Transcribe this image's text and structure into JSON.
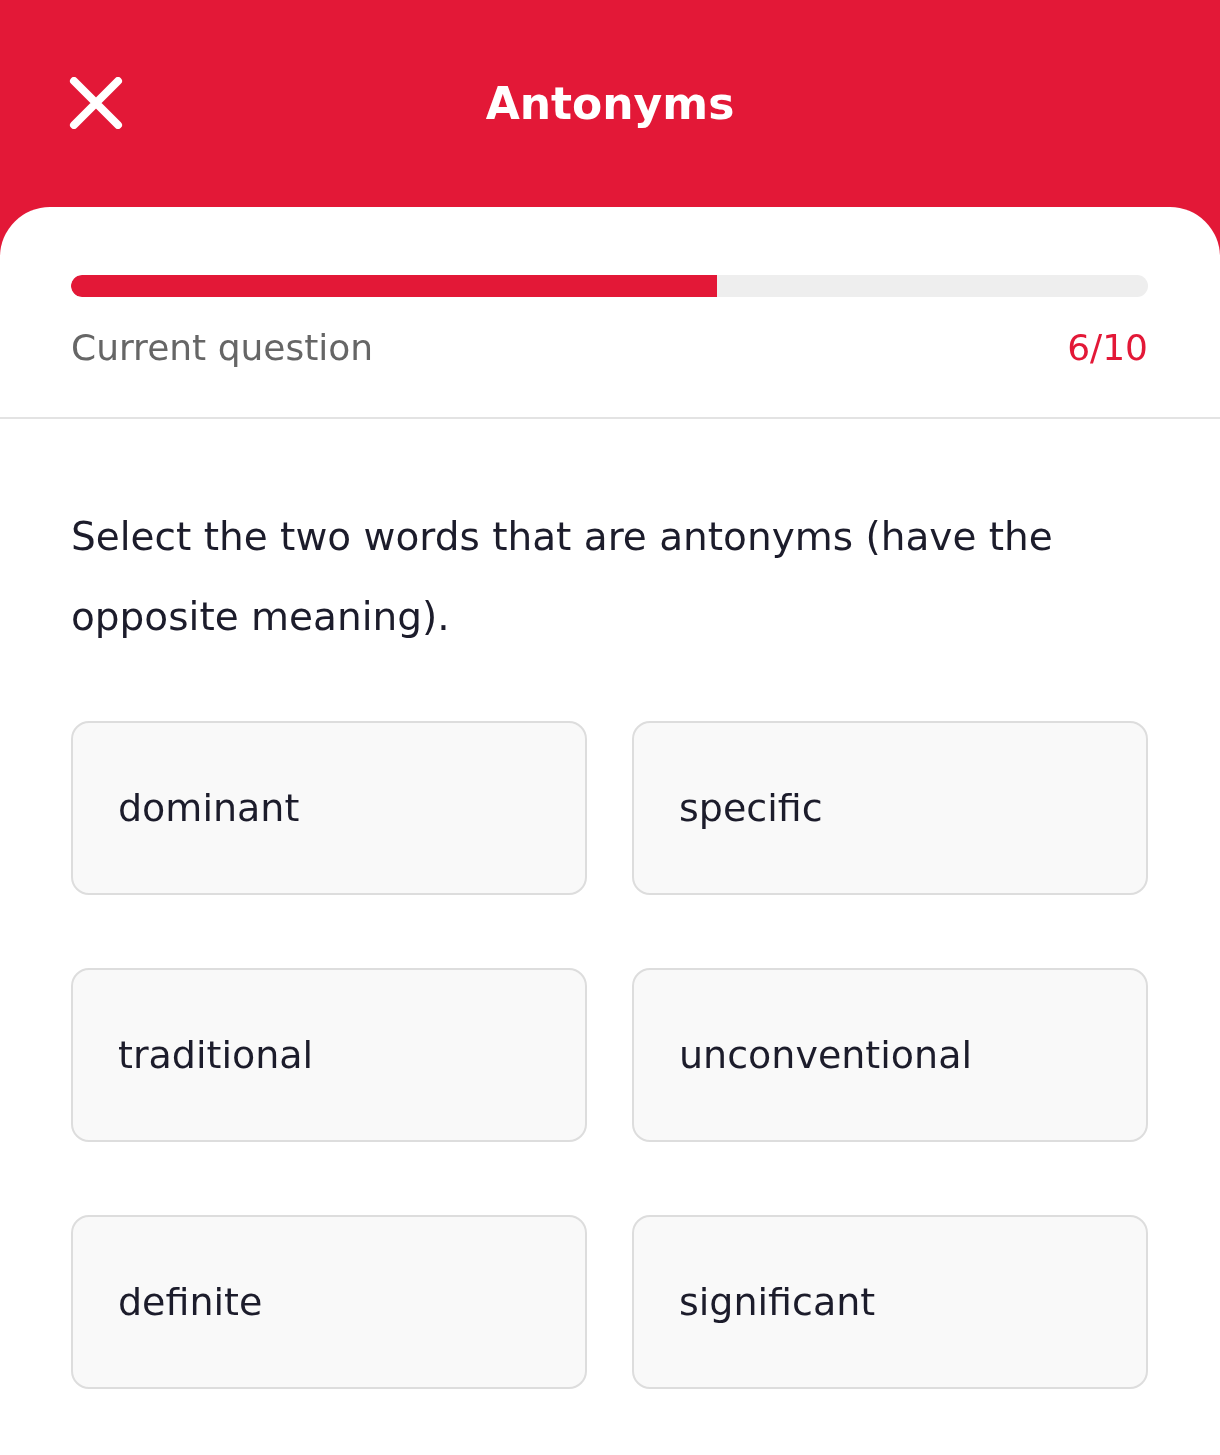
{
  "header": {
    "title": "Antonyms"
  },
  "progress": {
    "level": 0.6,
    "label": "Current question",
    "count": "6/10"
  },
  "question": "Select the two words that are antonyms (have the opposite meaning).",
  "options": [
    {
      "label": "dominant",
      "selected": false
    },
    {
      "label": "specific",
      "selected": false
    },
    {
      "label": "traditional",
      "selected": false
    },
    {
      "label": "unconventional",
      "selected": false
    },
    {
      "label": "definite",
      "selected": false
    },
    {
      "label": "significant",
      "selected": false
    }
  ]
}
